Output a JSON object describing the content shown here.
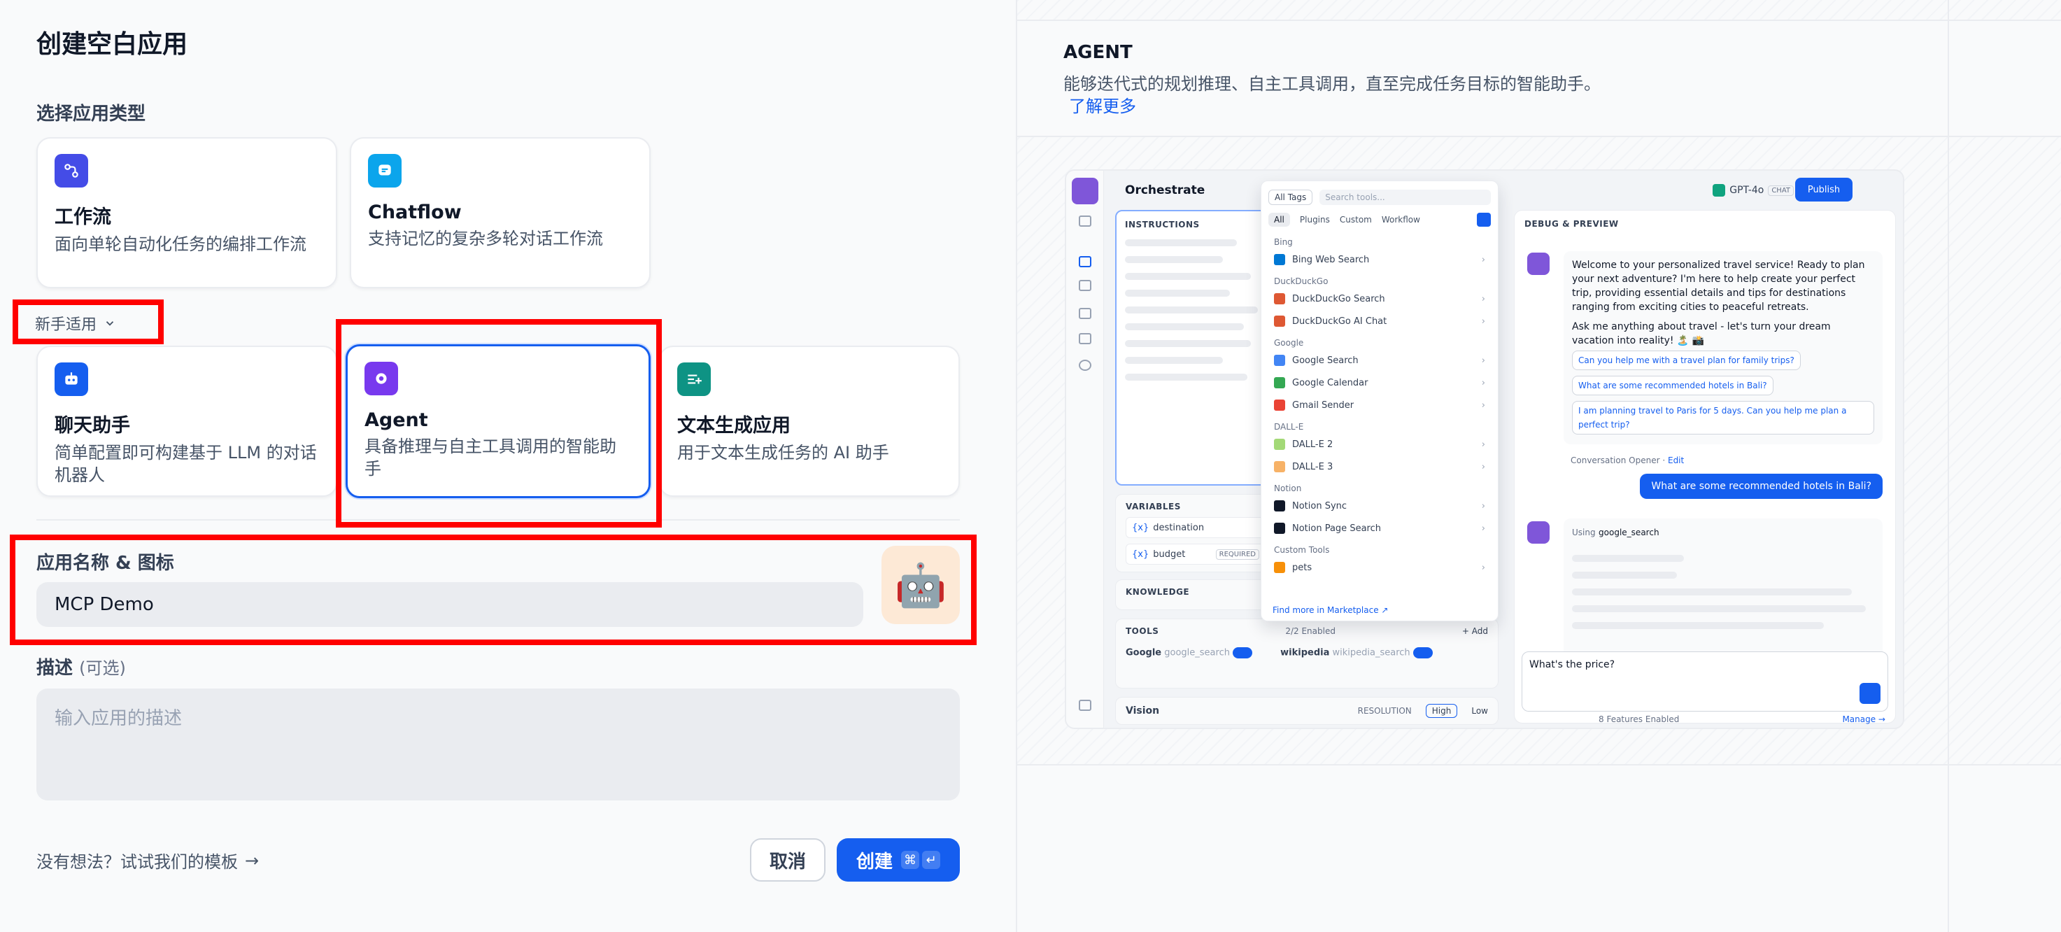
{
  "left": {
    "title": "创建空白应用",
    "section_type": "选择应用类型",
    "cards_top": [
      {
        "title": "工作流",
        "desc": "面向单轮自动化任务的编排工作流",
        "icon": "workflow-icon",
        "color": "#444ce7"
      },
      {
        "title": "Chatflow",
        "desc": "支持记忆的复杂多轮对话工作流",
        "icon": "chatflow-icon",
        "color": "#0ba5ec"
      }
    ],
    "beginner_label": "新手适用",
    "cards_bottom": [
      {
        "title": "聊天助手",
        "desc": "简单配置即可构建基于 LLM 的对话机器人",
        "icon": "chat-bot-icon",
        "color": "#155eef"
      },
      {
        "title": "Agent",
        "desc": "具备推理与自主工具调用的智能助手",
        "icon": "agent-icon",
        "color": "#7839ee"
      },
      {
        "title": "文本生成应用",
        "desc": "用于文本生成任务的 AI 助手",
        "icon": "text-generator-icon",
        "color": "#0e9384"
      }
    ],
    "name_label": "应用名称 & 图标",
    "name_value": "MCP Demo",
    "avatar": "🤖",
    "desc_label": "描述",
    "desc_optional": "(可选)",
    "desc_placeholder": "输入应用的描述",
    "template_link": "没有想法？试试我们的模板",
    "template_arrow": "→",
    "cancel": "取消",
    "create": "创建",
    "kbd_cmd": "⌘",
    "kbd_enter": "↵"
  },
  "right": {
    "heading": "AGENT",
    "desc": "能够迭代式的规划推理、自主工具调用，直至完成任务目标的智能助手。",
    "learn_more": "了解更多",
    "preview": {
      "orchestrate": "Orchestrate",
      "model": "GPT-4o",
      "model_chip": "CHAT",
      "publish": "Publish",
      "instructions": "INSTRUCTIONS",
      "variables": "VARIABLES",
      "var1": "destination",
      "var2": "budget",
      "required": "REQUIRED",
      "knowledge": "KNOWLEDGE",
      "tools": "TOOLS",
      "tools_enabled": "2/2 Enabled",
      "add": "+ Add",
      "tool1": "Google",
      "tool1_id": "google_search",
      "tool2": "wikipedia",
      "tool2_id": "wikipedia_search",
      "vision": "Vision",
      "resolution": "RESOLUTION",
      "high": "High",
      "low": "Low",
      "dd": {
        "tags": "All Tags",
        "search": "Search tools...",
        "tabs": [
          "All",
          "Plugins",
          "Custom",
          "Workflow"
        ],
        "groups": [
          {
            "name": "Bing",
            "items": [
              {
                "label": "Bing Web Search",
                "color": "#0078d4"
              }
            ]
          },
          {
            "name": "DuckDuckGo",
            "items": [
              {
                "label": "DuckDuckGo Search",
                "color": "#de5833"
              },
              {
                "label": "DuckDuckGo AI Chat",
                "color": "#de5833"
              }
            ]
          },
          {
            "name": "Google",
            "items": [
              {
                "label": "Google Search",
                "color": "#4285f4"
              },
              {
                "label": "Google Calendar",
                "color": "#34a853"
              },
              {
                "label": "Gmail Sender",
                "color": "#ea4335"
              }
            ]
          },
          {
            "name": "DALL-E",
            "items": [
              {
                "label": "DALL-E 2",
                "color": "#a3d977"
              },
              {
                "label": "DALL-E 3",
                "color": "#f7b267"
              }
            ]
          },
          {
            "name": "Notion",
            "items": [
              {
                "label": "Notion Sync",
                "color": "#101828"
              },
              {
                "label": "Notion Page Search",
                "color": "#101828"
              }
            ]
          },
          {
            "name": "Custom Tools",
            "items": [
              {
                "label": "pets",
                "color": "#f79009"
              }
            ]
          }
        ],
        "footer": "Find more in Marketplace ↗"
      },
      "debug": {
        "title": "DEBUG & PREVIEW",
        "welcome": "Welcome to your personalized travel service! Ready to plan your next adventure? I'm here to help create your perfect trip, providing essential details and tips for destinations ranging from exciting cities to peaceful retreats.",
        "ask": "Ask me anything about travel - let's turn your dream vacation into reality! 🏝️ 📸",
        "suggestions": [
          "Can you help me with a travel plan for family trips?",
          "What are some recommended hotels in Bali?",
          "I am planning travel to Paris for 5 days. Can you help me plan a perfect trip?"
        ],
        "opener": "Conversation Opener",
        "edit": "Edit",
        "user_msg": "What are some recommended hotels in Bali?",
        "using": "Using",
        "using_tool": "google_search",
        "input": "What's the price?",
        "features": "8 Features Enabled",
        "manage": "Manage →"
      }
    }
  }
}
